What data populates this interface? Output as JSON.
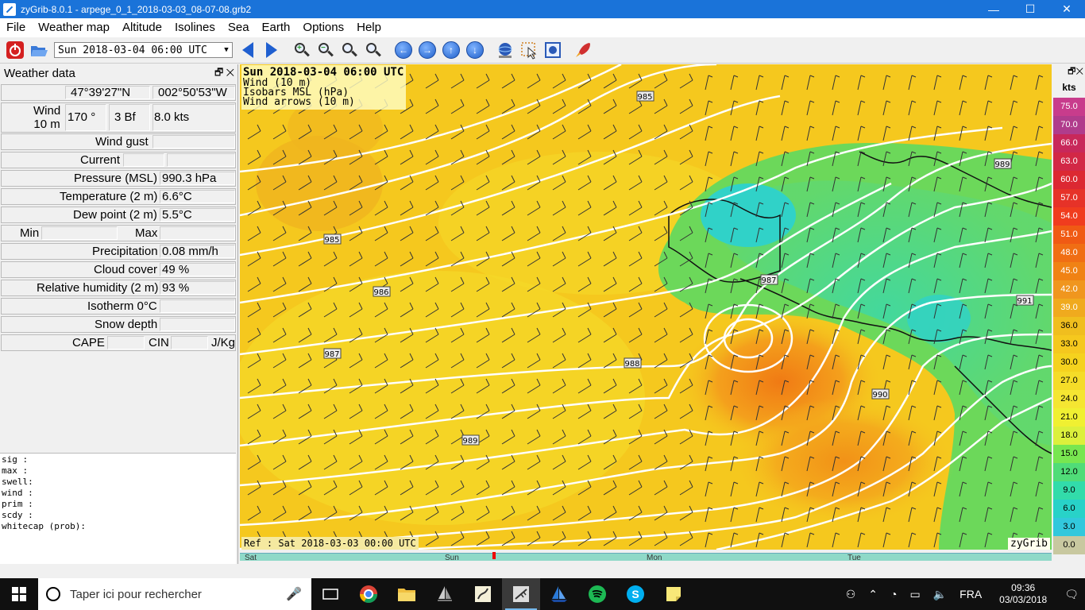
{
  "window": {
    "title": "zyGrib-8.0.1 - arpege_0_1_2018-03-03_08-07-08.grb2",
    "minimize": "—",
    "maximize": "☐",
    "close": "✕"
  },
  "menu": [
    "File",
    "Weather map",
    "Altitude",
    "Isolines",
    "Sea",
    "Earth",
    "Options",
    "Help"
  ],
  "toolbar": {
    "date_value": "Sun 2018-03-04 06:00 UTC"
  },
  "panel": {
    "title": "Weather data",
    "latitude": "47°39'27\"N",
    "longitude": "002°50'53\"W",
    "wind_label_1": "Wind",
    "wind_label_2": "10 m",
    "wind_dir": "170 °",
    "wind_bf": "3 Bf",
    "wind_kts": "8.0  kts",
    "wind_gust_label": "Wind gust",
    "current_label": "Current",
    "pressure_label": "Pressure (MSL)",
    "pressure_value": "990.3 hPa",
    "temp_label": "Temperature (2 m)",
    "temp_value": "6.6°C",
    "dew_label": "Dew point (2 m)",
    "dew_value": "5.5°C",
    "min_label": "Min",
    "max_label": "Max",
    "precip_label": "Precipitation",
    "precip_value": "0.08 mm/h",
    "cloud_label": "Cloud cover",
    "cloud_value": "49 %",
    "rh_label": "Relative humidity (2 m)",
    "rh_value": "93 %",
    "iso_label": "Isotherm 0°C",
    "snow_label": "Snow depth",
    "cape_label": "CAPE",
    "cin_label": "CIN",
    "jkg_label": "J/Kg",
    "wave_lines": [
      "sig  :",
      "max  :",
      "swell:",
      "wind :",
      "prim :",
      "scdy :",
      "whitecap (prob):"
    ]
  },
  "map": {
    "info_main": "Sun 2018-03-04 06:00 UTC",
    "info_lines": [
      "Wind (10 m)",
      "Isobars MSL (hPa)",
      "Wind arrows (10 m)"
    ],
    "ref": "Ref : Sat 2018-03-03 00:00 UTC",
    "brand": "zyGrib",
    "isobar_labels": [
      "985",
      "989",
      "985",
      "987",
      "986",
      "991",
      "987",
      "988",
      "990",
      "989"
    ]
  },
  "timeline": {
    "days": [
      "Sat",
      "Sun",
      "Mon",
      "Tue"
    ]
  },
  "legend": {
    "unit": "kts",
    "values": [
      "75.0",
      "70.0",
      "66.0",
      "63.0",
      "60.0",
      "57.0",
      "54.0",
      "51.0",
      "48.0",
      "45.0",
      "42.0",
      "39.0",
      "36.0",
      "33.0",
      "30.0",
      "27.0",
      "24.0",
      "21.0",
      "18.0",
      "15.0",
      "12.0",
      "9.0",
      "6.0",
      "3.0",
      "0.0"
    ],
    "colors": [
      "#c83c8c",
      "#b03c8c",
      "#c8285a",
      "#d22846",
      "#dc2832",
      "#e63228",
      "#f03c1e",
      "#f05a14",
      "#f06e14",
      "#f08214",
      "#f0961e",
      "#f0aa1e",
      "#f0be1e",
      "#f5c81e",
      "#f5d21e",
      "#f5dc28",
      "#f5e632",
      "#f0f032",
      "#dcf03c",
      "#78e650",
      "#50dc78",
      "#32dcaa",
      "#28d2c8",
      "#32c8dc",
      "#c8c8a0"
    ]
  },
  "taskbar": {
    "search_placeholder": "Taper ici pour rechercher",
    "lang": "FRA",
    "time": "09:36",
    "date": "03/03/2018"
  }
}
